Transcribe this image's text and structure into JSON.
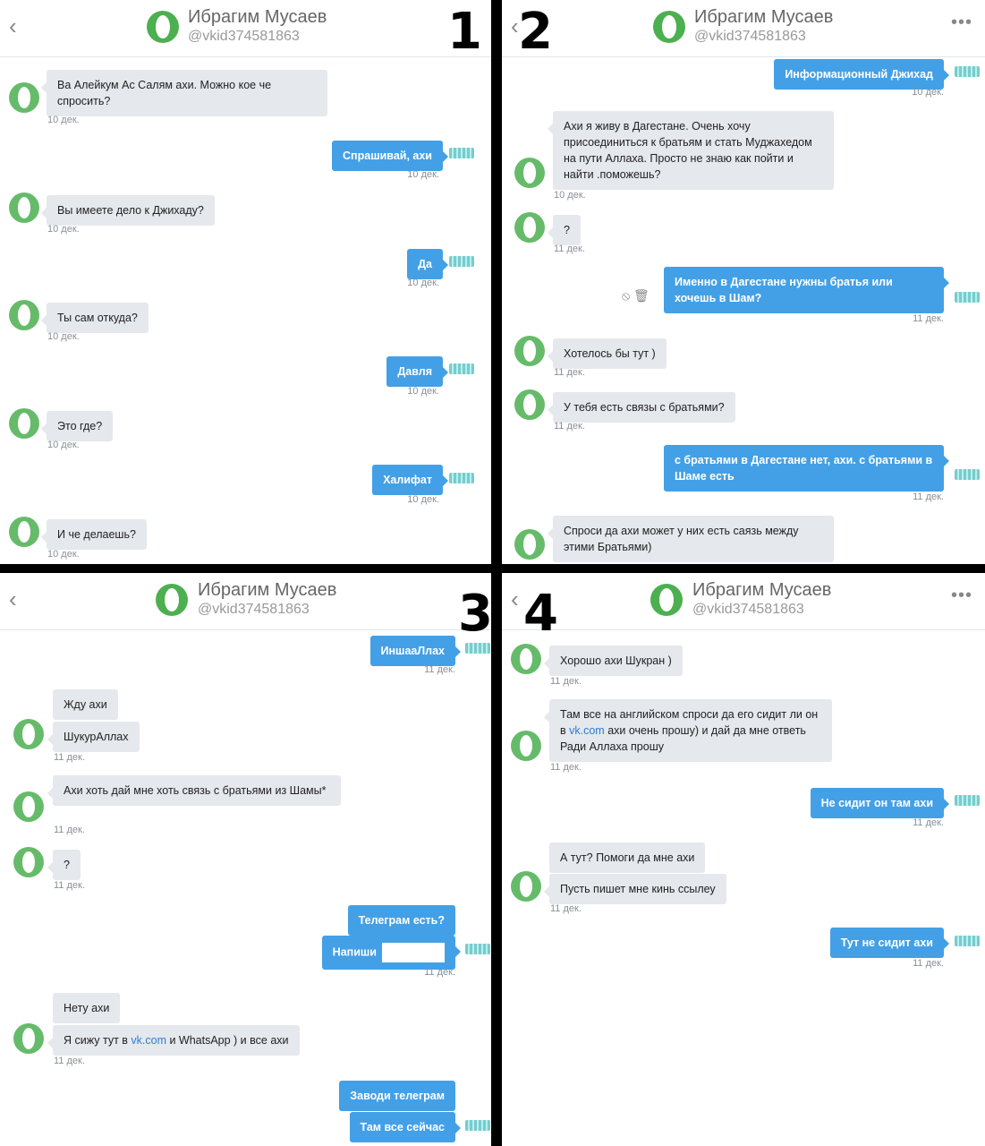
{
  "contact": {
    "name": "Ибрагим Мусаев",
    "handle": "@vkid374581863"
  },
  "panel_numbers": [
    "1",
    "2",
    "3",
    "4"
  ],
  "p1": {
    "m1": "Ва Алейкум Ас Салям ахи. Можно кое че спросить?",
    "m2": "Спрашивай, ахи",
    "m3": "Вы имеете дело к Джихаду?",
    "m4": "Да",
    "m5": "Ты сам откуда?",
    "m6": "Давля",
    "m7": "Это где?",
    "m8": "Халифат",
    "m9": "И че делаешь?",
    "t": "10 дек."
  },
  "p2": {
    "m1": "Информационный Джихад",
    "m2": "Ахи я живу в Дагестане. Очень хочу присоединиться к братьям и стать Муджахедом на пути Аллаха. Просто не знаю как пойти и найти .поможешь?",
    "m3": "?",
    "m4": "Именно в Дагестане нужны братья или хочешь в Шам?",
    "m5": "Хотелось бы тут )",
    "m6": "У тебя есть связы с братьями?",
    "m7": "с братьями в Дагестане нет, ахи. с братьями в Шаме есть",
    "m8": "Спроси да ахи может у них есть саязь между этими Братьями)",
    "t10": "10 дек.",
    "t11": "11 дек.",
    "icons": "⦸ 🗑"
  },
  "p3": {
    "m1": "ИншааЛлах",
    "m2": "Жду ахи",
    "m3": "ШукурАллах",
    "m4": "Ахи  хоть дай мне хоть связь с братьями  из Шамы*",
    "m5": "?",
    "m6": "Телеграм есть?",
    "m7": "Напиши",
    "m8": "Нету ахи",
    "m9a": "Я сижу тут в ",
    "m9link": "vk.com",
    "m9b": " и  WhatsApp ) и все ахи",
    "m10": "Заводи телеграм",
    "m11": "Там все сейчас",
    "t": "11 дек."
  },
  "p4": {
    "m1": "Хорошо ахи Шукран )",
    "m2a": "Там все на английском спроси да его сидит ли он в ",
    "m2link": "vk.com",
    "m2b": " ахи очень прошу) и дай да мне ответь Ради Аллаха прошу",
    "m3": "Не сидит он там ахи",
    "m4": "А тут? Помоги да мне ахи",
    "m5": "Пусть пишет мне кинь ссылеу",
    "m6": "Тут не сидит ахи",
    "t": "11 дек."
  }
}
